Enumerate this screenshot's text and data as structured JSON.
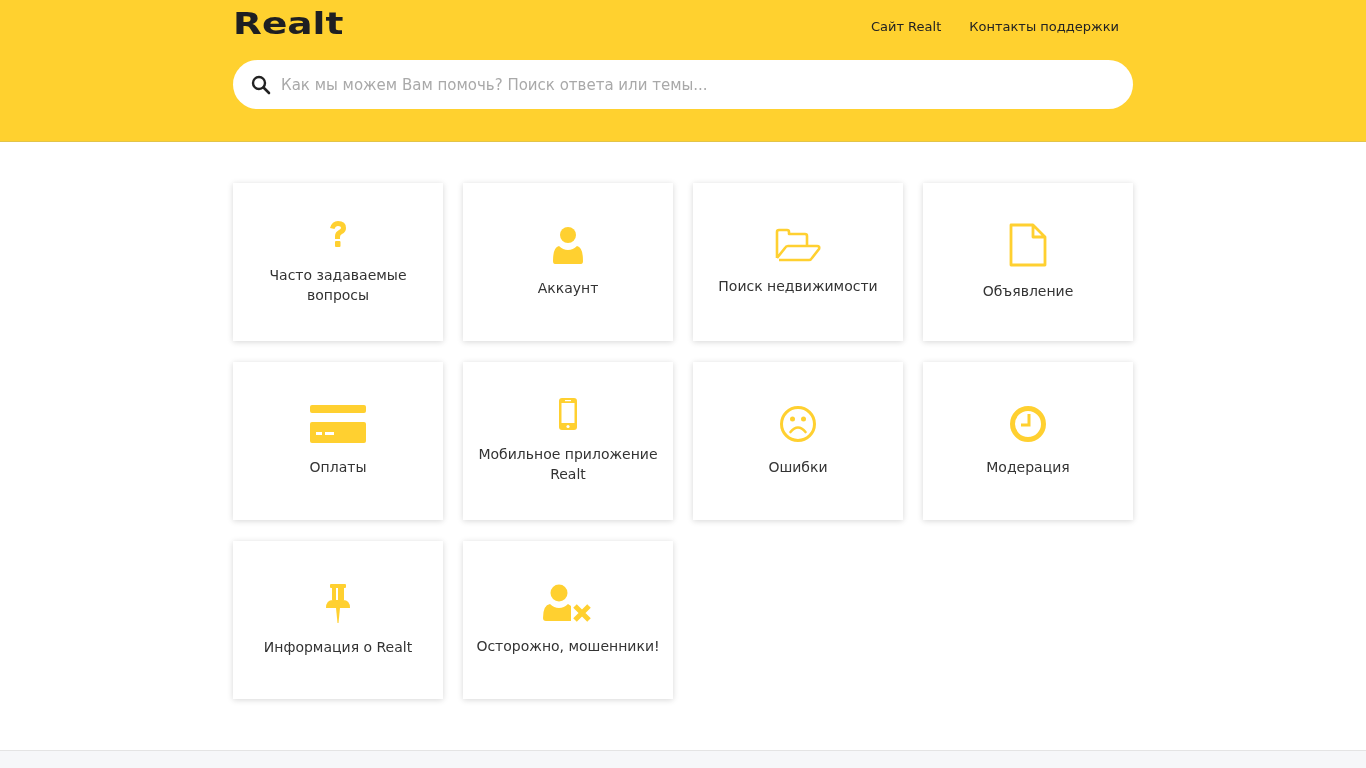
{
  "header": {
    "logo": "Realt",
    "links": [
      "Сайт Realt",
      "Контакты поддержки"
    ],
    "search": {
      "placeholder": "Как мы можем Вам помочь? Поиск ответа или темы..."
    }
  },
  "categories": [
    {
      "kind": "question",
      "label": "Часто задаваемые вопросы"
    },
    {
      "kind": "user",
      "label": "Аккаунт"
    },
    {
      "kind": "folder",
      "label": "Поиск недвижимости"
    },
    {
      "kind": "file",
      "label": "Объявление"
    },
    {
      "kind": "card",
      "label": "Оплаты"
    },
    {
      "kind": "phone",
      "label": "Мобильное приложение Realt"
    },
    {
      "kind": "sad",
      "label": "Ошибки"
    },
    {
      "kind": "clock",
      "label": "Модерация"
    },
    {
      "kind": "pin",
      "label": "Информация о Realt"
    },
    {
      "kind": "userx",
      "label": "Осторожно, мошенники!"
    }
  ]
}
